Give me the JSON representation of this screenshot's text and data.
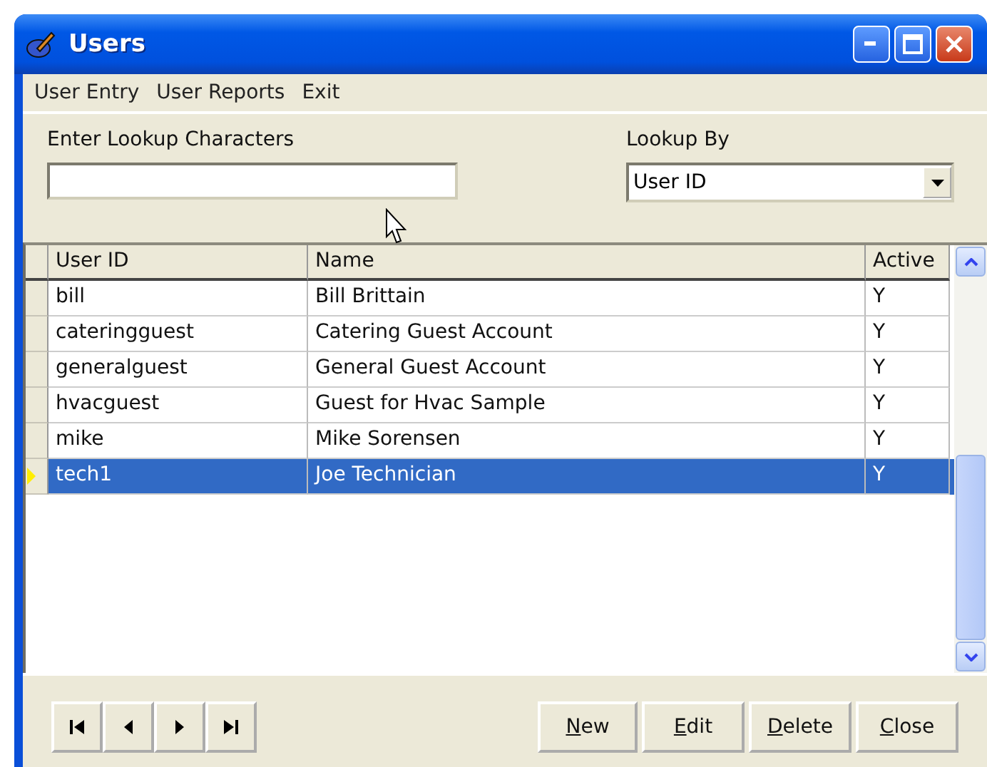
{
  "window": {
    "title": "Users"
  },
  "menu": [
    "User Entry",
    "User Reports",
    "Exit"
  ],
  "lookup": {
    "label": "Enter Lookup Characters",
    "by_label": "Lookup By",
    "by_value": "User ID"
  },
  "table": {
    "columns": [
      "User ID",
      "Name",
      "Active"
    ],
    "rows": [
      {
        "cells": [
          "bill",
          "Bill Brittain",
          "Y"
        ],
        "selected": false
      },
      {
        "cells": [
          "cateringguest",
          "Catering Guest Account",
          "Y"
        ],
        "selected": false
      },
      {
        "cells": [
          "generalguest",
          "General Guest Account",
          "Y"
        ],
        "selected": false
      },
      {
        "cells": [
          "hvacguest",
          "Guest for Hvac Sample",
          "Y"
        ],
        "selected": false
      },
      {
        "cells": [
          "mike",
          "Mike Sorensen",
          "Y"
        ],
        "selected": false
      },
      {
        "cells": [
          "tech1",
          "Joe Technician",
          "Y"
        ],
        "selected": true
      }
    ]
  },
  "navigation": [
    {
      "kind": "first"
    },
    {
      "kind": "prev"
    },
    {
      "kind": "next"
    },
    {
      "kind": "last"
    }
  ],
  "buttons": [
    "New",
    "Edit",
    "Delete",
    "Close"
  ]
}
